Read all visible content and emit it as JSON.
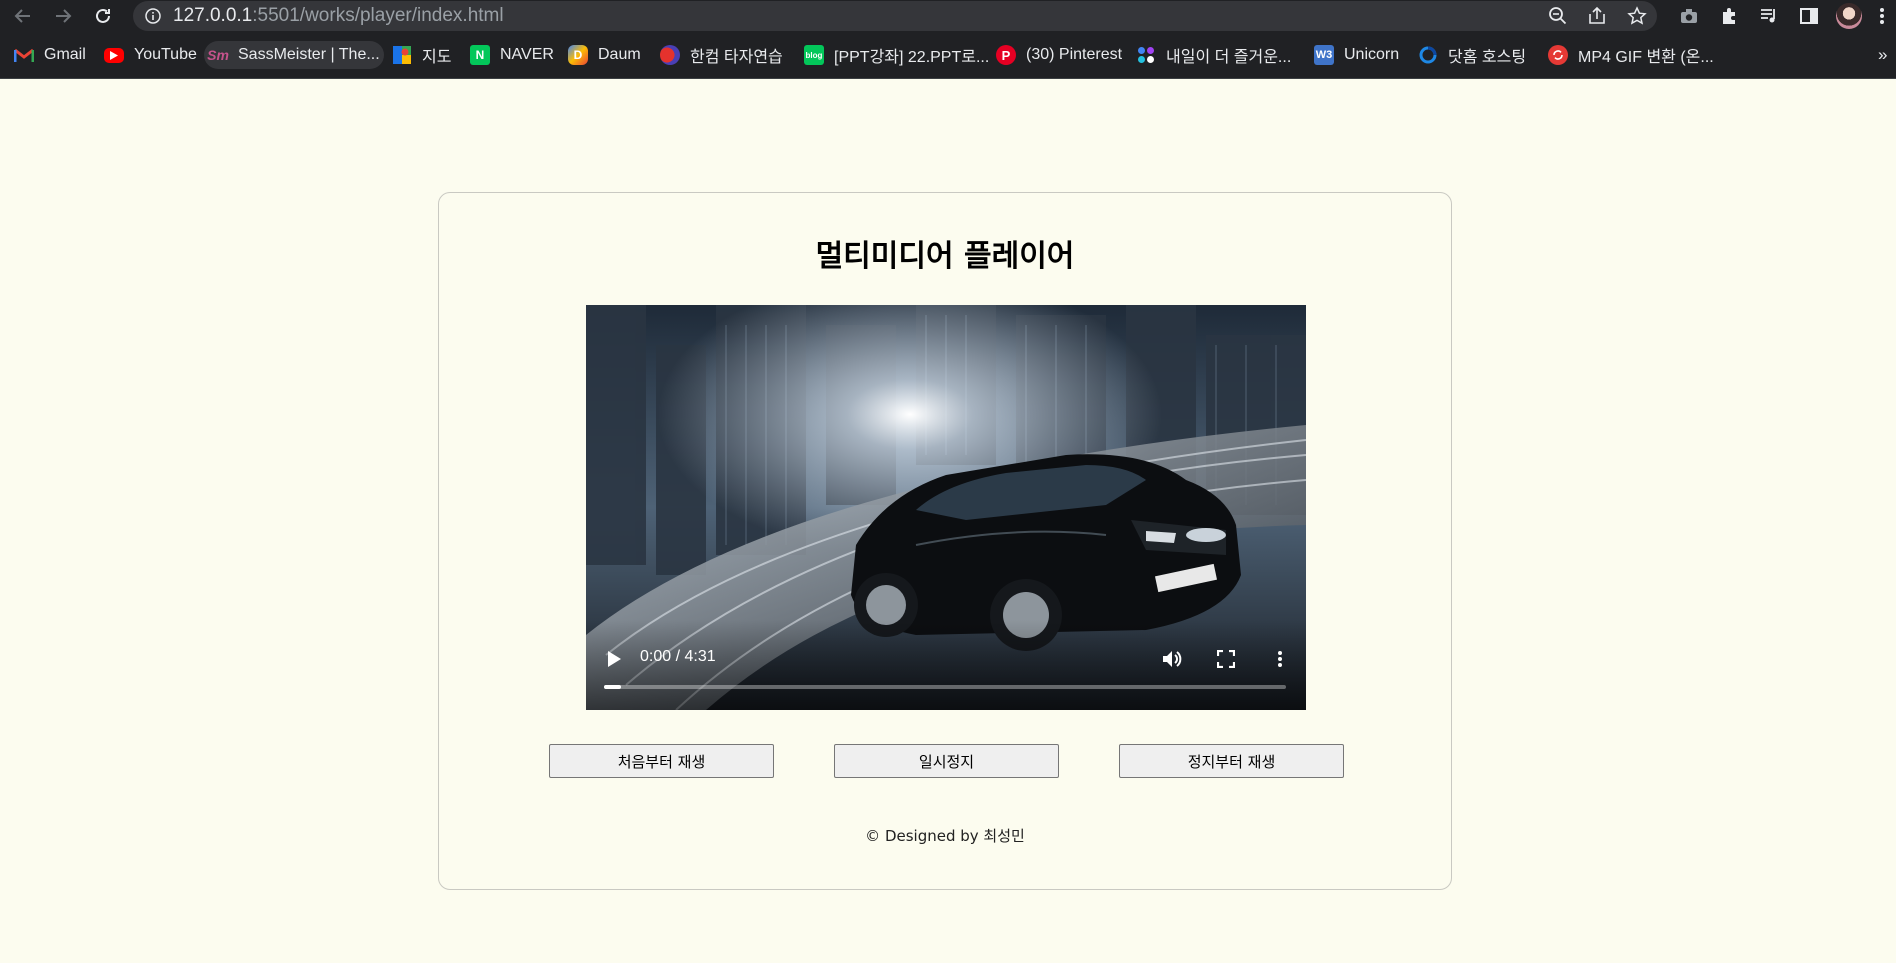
{
  "browser": {
    "url_host": "127.0.0.1",
    "url_rest": ":5501/works/player/index.html"
  },
  "bookmarks": [
    {
      "label": "Gmail",
      "icon": "gmail-icon"
    },
    {
      "label": "YouTube",
      "icon": "youtube-icon"
    },
    {
      "label": "SassMeister | The...",
      "icon": "sassmeister-icon"
    },
    {
      "label": "지도",
      "icon": "maps-icon"
    },
    {
      "label": "NAVER",
      "icon": "naver-icon"
    },
    {
      "label": "Daum",
      "icon": "daum-icon"
    },
    {
      "label": "한컴 타자연습",
      "icon": "hancom-icon"
    },
    {
      "label": "[PPT강좌] 22.PPT로...",
      "icon": "blog-icon"
    },
    {
      "label": "(30) Pinterest",
      "icon": "pinterest-icon"
    },
    {
      "label": "내일이 더 즐거운...",
      "icon": "dots-icon"
    },
    {
      "label": "Unicorn",
      "icon": "w3-icon"
    },
    {
      "label": "닷홈 호스팅",
      "icon": "dothome-icon"
    },
    {
      "label": "MP4 GIF 변환 (온...",
      "icon": "convert-icon"
    }
  ],
  "bookmarks_overflow": "»",
  "page": {
    "title": "멀티미디어 플레이어",
    "video": {
      "time": "0:00 / 4:31",
      "progress_fraction": 0.0
    },
    "buttons": {
      "restart": "처음부터 재생",
      "pause": "일시정지",
      "resume": "정지부터 재생"
    },
    "footer": "© Designed by 최성민"
  }
}
